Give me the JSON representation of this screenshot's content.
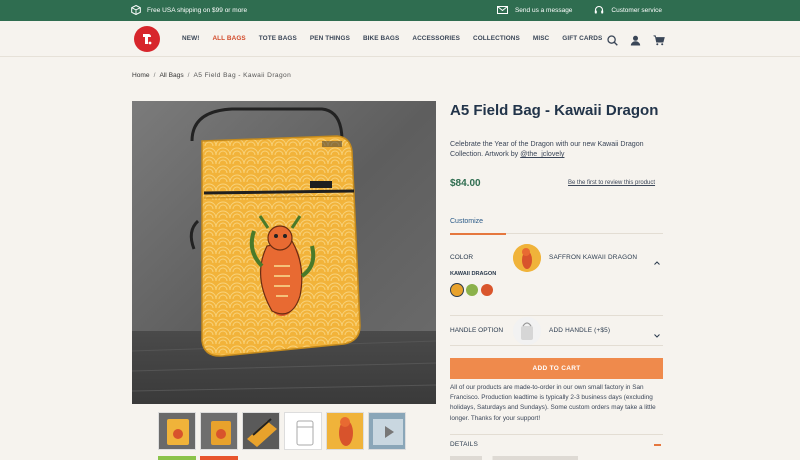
{
  "topbar": {
    "shipping": "Free USA shipping on $99 or more",
    "message": "Send us a message",
    "service": "Customer service"
  },
  "nav": {
    "items": [
      {
        "label": "NEW!"
      },
      {
        "label": "ALL BAGS"
      },
      {
        "label": "TOTE BAGS"
      },
      {
        "label": "PEN THINGS"
      },
      {
        "label": "BIKE BAGS"
      },
      {
        "label": "ACCESSORIES"
      },
      {
        "label": "COLLECTIONS"
      },
      {
        "label": "MISC"
      },
      {
        "label": "GIFT CARDS"
      }
    ],
    "active_index": 1
  },
  "breadcrumb": {
    "home": "Home",
    "sep": "/",
    "category": "All Bags",
    "current": "A5 Field Bag - Kawaii Dragon"
  },
  "product": {
    "title": "A5 Field Bag - Kawaii Dragon",
    "description": "Celebrate the Year of the Dragon with our new Kawaii Dragon Collection. Artwork by ",
    "artist": "@the_jclovely",
    "price": "$84.00",
    "review_link": "Be the first to review this product"
  },
  "customize": {
    "tab_label": "Customize",
    "color_label": "COLOR",
    "color_value": "SAFFRON KAWAII DRAGON",
    "group_label": "KAWAII DRAGON",
    "swatches": [
      {
        "name": "saffron",
        "color": "#e8a22c",
        "selected": true
      },
      {
        "name": "green",
        "color": "#8bb14a",
        "selected": false
      },
      {
        "name": "red",
        "color": "#d9552c",
        "selected": false
      }
    ],
    "handle_label": "HANDLE OPTION",
    "handle_value": "ADD HANDLE (+$5)"
  },
  "cart": {
    "button": "ADD TO CART"
  },
  "notice": "All of our products are made-to-order in our own small factory in San Francisco. Production leadtime is typically 2-3 business days (excluding holidays, Saturdays and Sundays). Some custom orders may take a little longer. Thanks for your support!",
  "details": {
    "label": "DETAILS"
  },
  "colors": {
    "brand_green": "#2f6d50",
    "accent_orange": "#ef8a4c",
    "logo_red": "#d7262c",
    "bag_yellow": "#f0b73a"
  }
}
